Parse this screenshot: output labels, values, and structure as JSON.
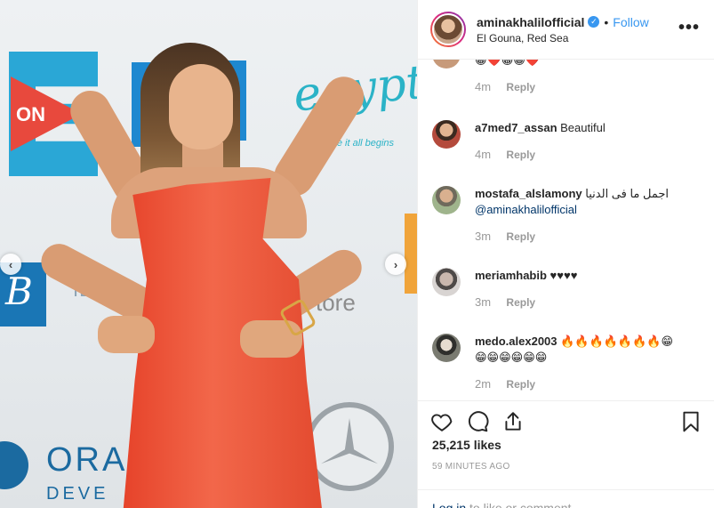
{
  "post": {
    "username": "aminakhalilofficial",
    "location": "El Gouna, Red Sea",
    "follow_label": "Follow",
    "dot": "•",
    "more_label": "•••"
  },
  "photo": {
    "logos": {
      "on": "ON",
      "egypt": "egypt",
      "egypt_tagline": "where it all begins",
      "b": "B",
      "hilton": "ILTON",
      "ora": "ORA",
      "deve": "DEVE",
      "store": "tore"
    },
    "prev_icon": "chevron-left-icon",
    "next_icon": "chevron-right-icon",
    "prev_glyph": "‹",
    "next_glyph": "›"
  },
  "comments": [
    {
      "user": "",
      "text": "😁❤️😁😁❤️",
      "time": "4m",
      "reply": "Reply",
      "avatar_color": "#c79a7a"
    },
    {
      "user": "a7med7_assan",
      "text": "Beautiful",
      "time": "4m",
      "reply": "Reply",
      "avatar_color": "#b44a3c"
    },
    {
      "user": "mostafa_alslamony",
      "text": "اجمل ما فى الدنيا",
      "mention": "@aminakhalilofficial",
      "time": "3m",
      "reply": "Reply",
      "avatar_color": "#8a9a7c"
    },
    {
      "user": "meriamhabib",
      "text": "♥♥♥♥",
      "time": "3m",
      "reply": "Reply",
      "avatar_color": "#b5b0ad"
    },
    {
      "user": "medo.alex2003",
      "text": "🔥🔥🔥🔥🔥🔥🔥😁",
      "text2": "😁😁😁😁😁😁",
      "time": "2m",
      "reply": "Reply",
      "avatar_color": "#5d5e56"
    }
  ],
  "actions": {
    "like_icon": "heart-icon",
    "comment_icon": "comment-icon",
    "share_icon": "share-icon",
    "save_icon": "bookmark-icon"
  },
  "likes": "25,215 likes",
  "time_ago": "59 MINUTES AGO",
  "login": {
    "link": "Log in",
    "rest": " to like or comment."
  },
  "colors": {
    "accent": "#3897f0",
    "link": "#003569",
    "muted": "#999999",
    "dress": "#e6432a"
  }
}
